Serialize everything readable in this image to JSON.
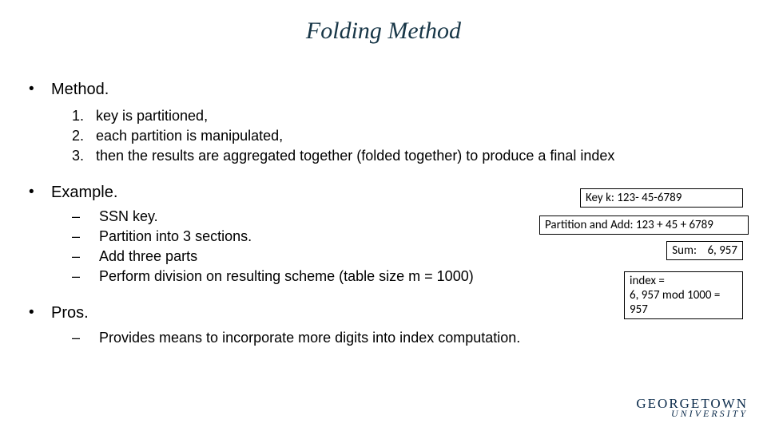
{
  "title": "Folding Method",
  "sections": {
    "method": {
      "label": "Method.",
      "steps": [
        "key is partitioned,",
        "each partition is manipulated,",
        "then the results are aggregated together (folded together) to produce a final index"
      ]
    },
    "example": {
      "label": "Example.",
      "items": [
        "SSN key.",
        "Partition into 3 sections.",
        "Add three parts",
        "Perform division on resulting scheme (table size m = 1000)"
      ]
    },
    "pros": {
      "label": "Pros.",
      "items": [
        "Provides means to incorporate more digits into index computation."
      ]
    }
  },
  "boxes": {
    "key": "Key k: 123- 45-6789",
    "partition": "Partition and Add: 123 + 45 + 6789",
    "sum_label": "Sum:",
    "sum_value": "6, 957",
    "index": "index =\n6, 957 mod 1000 =\n957"
  },
  "logo": {
    "line1": "GEORGETOWN",
    "line2": "UNIVERSITY"
  }
}
